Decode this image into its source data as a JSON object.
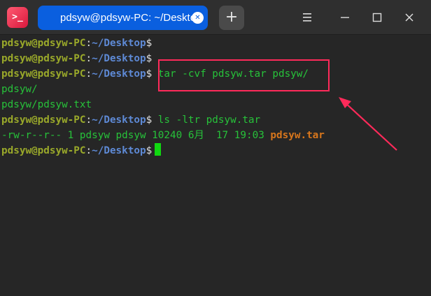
{
  "window": {
    "app_icon_text": ">_",
    "tab_title": "pdsyw@pdsyw-PC: ~/Desktop",
    "tab_close_glyph": "✕",
    "new_tab_glyph": "+",
    "menu_icon": "hamburger-menu-icon",
    "minimize_icon": "minimize-icon",
    "maximize_icon": "maximize-icon",
    "close_icon": "close-icon"
  },
  "terminal": {
    "user_host": "pdsyw@pdsyw-PC",
    "path_sep": ":",
    "path": "~/Desktop",
    "prompt_char": "$",
    "lines": {
      "cmd_tar": " tar -cvf pdsyw.tar pdsyw/",
      "out_dir": "pdsyw/",
      "out_file": "pdsyw/pdsyw.txt",
      "cmd_ls": " ls -ltr pdsyw.tar",
      "ls_meta": "-rw-r--r-- 1 pdsyw pdsyw 10240 6月  17 19:03 ",
      "ls_name": "pdsyw.tar"
    }
  },
  "colors": {
    "tab_active": "#0a5fdf",
    "prompt_user": "#9aa92a",
    "prompt_path": "#5e8ad6",
    "command_text": "#27c23a",
    "archive_file": "#d7761c",
    "annotation": "#ff2a5a"
  }
}
